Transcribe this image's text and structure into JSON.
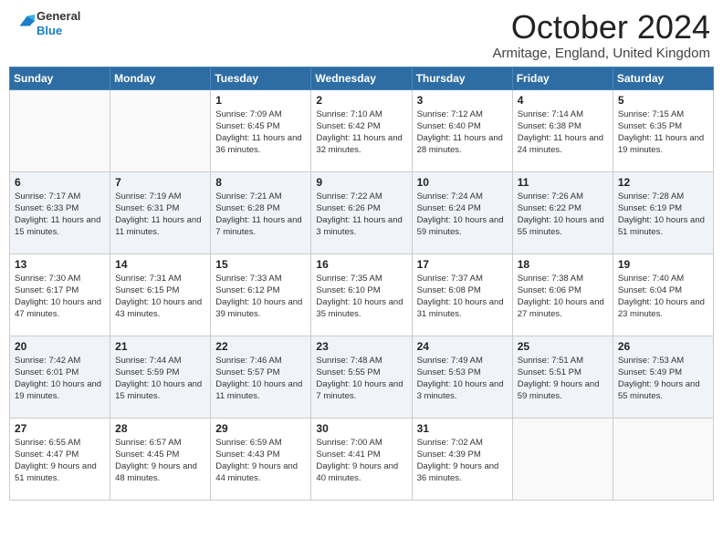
{
  "header": {
    "logo_general": "General",
    "logo_blue": "Blue",
    "month_title": "October 2024",
    "location": "Armitage, England, United Kingdom"
  },
  "days_of_week": [
    "Sunday",
    "Monday",
    "Tuesday",
    "Wednesday",
    "Thursday",
    "Friday",
    "Saturday"
  ],
  "weeks": [
    [
      {
        "day": "",
        "info": ""
      },
      {
        "day": "",
        "info": ""
      },
      {
        "day": "1",
        "info": "Sunrise: 7:09 AM\nSunset: 6:45 PM\nDaylight: 11 hours and 36 minutes."
      },
      {
        "day": "2",
        "info": "Sunrise: 7:10 AM\nSunset: 6:42 PM\nDaylight: 11 hours and 32 minutes."
      },
      {
        "day": "3",
        "info": "Sunrise: 7:12 AM\nSunset: 6:40 PM\nDaylight: 11 hours and 28 minutes."
      },
      {
        "day": "4",
        "info": "Sunrise: 7:14 AM\nSunset: 6:38 PM\nDaylight: 11 hours and 24 minutes."
      },
      {
        "day": "5",
        "info": "Sunrise: 7:15 AM\nSunset: 6:35 PM\nDaylight: 11 hours and 19 minutes."
      }
    ],
    [
      {
        "day": "6",
        "info": "Sunrise: 7:17 AM\nSunset: 6:33 PM\nDaylight: 11 hours and 15 minutes."
      },
      {
        "day": "7",
        "info": "Sunrise: 7:19 AM\nSunset: 6:31 PM\nDaylight: 11 hours and 11 minutes."
      },
      {
        "day": "8",
        "info": "Sunrise: 7:21 AM\nSunset: 6:28 PM\nDaylight: 11 hours and 7 minutes."
      },
      {
        "day": "9",
        "info": "Sunrise: 7:22 AM\nSunset: 6:26 PM\nDaylight: 11 hours and 3 minutes."
      },
      {
        "day": "10",
        "info": "Sunrise: 7:24 AM\nSunset: 6:24 PM\nDaylight: 10 hours and 59 minutes."
      },
      {
        "day": "11",
        "info": "Sunrise: 7:26 AM\nSunset: 6:22 PM\nDaylight: 10 hours and 55 minutes."
      },
      {
        "day": "12",
        "info": "Sunrise: 7:28 AM\nSunset: 6:19 PM\nDaylight: 10 hours and 51 minutes."
      }
    ],
    [
      {
        "day": "13",
        "info": "Sunrise: 7:30 AM\nSunset: 6:17 PM\nDaylight: 10 hours and 47 minutes."
      },
      {
        "day": "14",
        "info": "Sunrise: 7:31 AM\nSunset: 6:15 PM\nDaylight: 10 hours and 43 minutes."
      },
      {
        "day": "15",
        "info": "Sunrise: 7:33 AM\nSunset: 6:12 PM\nDaylight: 10 hours and 39 minutes."
      },
      {
        "day": "16",
        "info": "Sunrise: 7:35 AM\nSunset: 6:10 PM\nDaylight: 10 hours and 35 minutes."
      },
      {
        "day": "17",
        "info": "Sunrise: 7:37 AM\nSunset: 6:08 PM\nDaylight: 10 hours and 31 minutes."
      },
      {
        "day": "18",
        "info": "Sunrise: 7:38 AM\nSunset: 6:06 PM\nDaylight: 10 hours and 27 minutes."
      },
      {
        "day": "19",
        "info": "Sunrise: 7:40 AM\nSunset: 6:04 PM\nDaylight: 10 hours and 23 minutes."
      }
    ],
    [
      {
        "day": "20",
        "info": "Sunrise: 7:42 AM\nSunset: 6:01 PM\nDaylight: 10 hours and 19 minutes."
      },
      {
        "day": "21",
        "info": "Sunrise: 7:44 AM\nSunset: 5:59 PM\nDaylight: 10 hours and 15 minutes."
      },
      {
        "day": "22",
        "info": "Sunrise: 7:46 AM\nSunset: 5:57 PM\nDaylight: 10 hours and 11 minutes."
      },
      {
        "day": "23",
        "info": "Sunrise: 7:48 AM\nSunset: 5:55 PM\nDaylight: 10 hours and 7 minutes."
      },
      {
        "day": "24",
        "info": "Sunrise: 7:49 AM\nSunset: 5:53 PM\nDaylight: 10 hours and 3 minutes."
      },
      {
        "day": "25",
        "info": "Sunrise: 7:51 AM\nSunset: 5:51 PM\nDaylight: 9 hours and 59 minutes."
      },
      {
        "day": "26",
        "info": "Sunrise: 7:53 AM\nSunset: 5:49 PM\nDaylight: 9 hours and 55 minutes."
      }
    ],
    [
      {
        "day": "27",
        "info": "Sunrise: 6:55 AM\nSunset: 4:47 PM\nDaylight: 9 hours and 51 minutes."
      },
      {
        "day": "28",
        "info": "Sunrise: 6:57 AM\nSunset: 4:45 PM\nDaylight: 9 hours and 48 minutes."
      },
      {
        "day": "29",
        "info": "Sunrise: 6:59 AM\nSunset: 4:43 PM\nDaylight: 9 hours and 44 minutes."
      },
      {
        "day": "30",
        "info": "Sunrise: 7:00 AM\nSunset: 4:41 PM\nDaylight: 9 hours and 40 minutes."
      },
      {
        "day": "31",
        "info": "Sunrise: 7:02 AM\nSunset: 4:39 PM\nDaylight: 9 hours and 36 minutes."
      },
      {
        "day": "",
        "info": ""
      },
      {
        "day": "",
        "info": ""
      }
    ]
  ]
}
